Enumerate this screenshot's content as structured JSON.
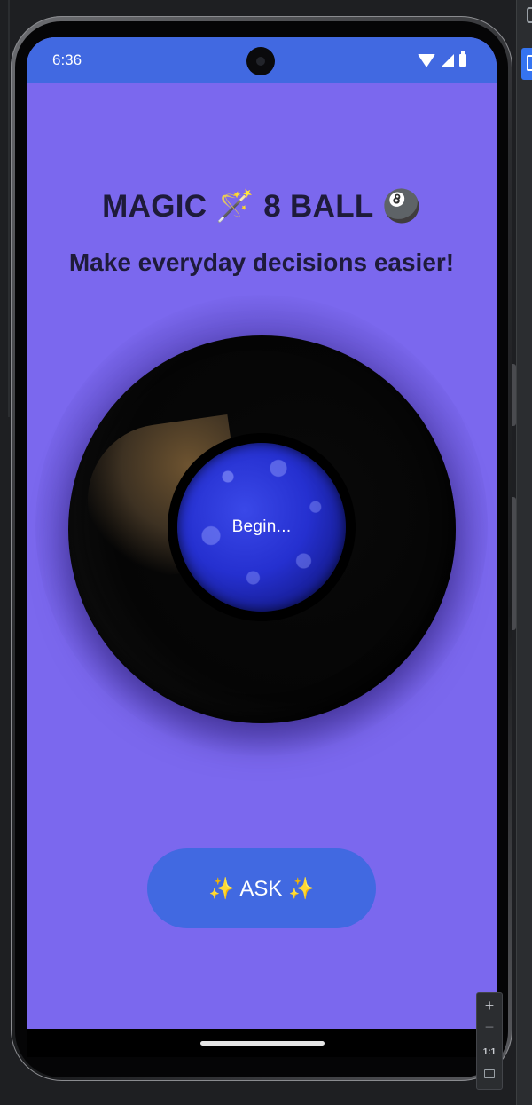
{
  "status_bar": {
    "time": "6:36"
  },
  "app": {
    "title": "MAGIC 🪄 8 BALL 🎱",
    "subtitle": "Make everyday decisions easier!",
    "ball_text": "Begin...",
    "ask_button_label": "✨ ASK ✨"
  },
  "emulator_controls": {
    "zoom_in": "+",
    "zoom_out": "−",
    "actual_size": "1:1"
  },
  "colors": {
    "screen_background": "#7b68ee",
    "status_bar": "#4169e1",
    "ask_button": "#4169e1",
    "title_text": "#1e1b3a",
    "ball_liquid": "#2530d0"
  },
  "icons": [
    "wifi-icon",
    "signal-icon",
    "battery-icon",
    "camera-cutout",
    "zoom-fit-icon"
  ]
}
